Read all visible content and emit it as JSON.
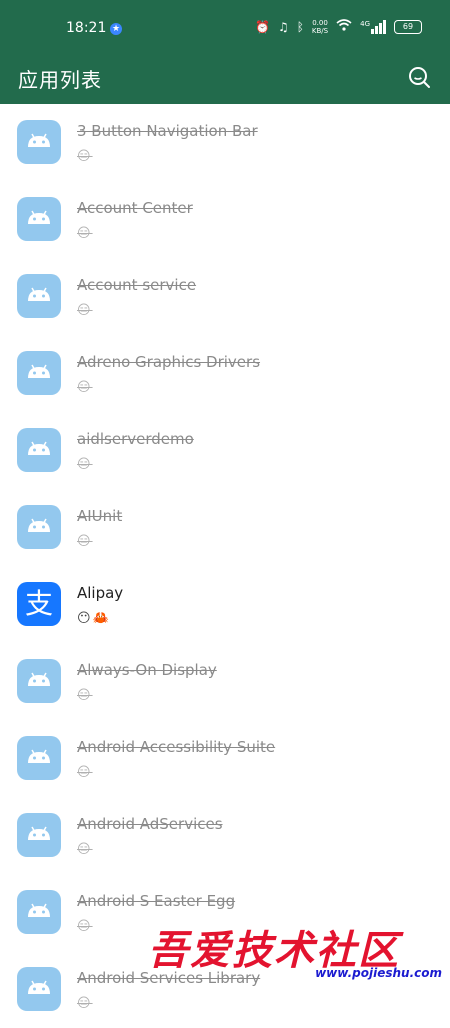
{
  "status": {
    "time": "18:21",
    "speed_value": "0.00",
    "speed_unit": "KB/S",
    "network": "4G",
    "battery": "69"
  },
  "appbar": {
    "title": "应用列表"
  },
  "apps": [
    {
      "name": "3 Button Navigation Bar",
      "emoji": "😑"
    },
    {
      "name": "Account Center",
      "emoji": "😑"
    },
    {
      "name": "Account service",
      "emoji": "😑"
    },
    {
      "name": "Adreno Graphics Drivers",
      "emoji": "😑"
    },
    {
      "name": "aidlserverdemo",
      "emoji": "😑"
    },
    {
      "name": "AIUnit",
      "emoji": "😑"
    },
    {
      "name": "Alipay",
      "emoji": "😶🦀"
    },
    {
      "name": "Always-On Display",
      "emoji": "😑"
    },
    {
      "name": "Android Accessibility Suite",
      "emoji": "😑"
    },
    {
      "name": "Android AdServices",
      "emoji": "😑"
    },
    {
      "name": "Android S Easter Egg",
      "emoji": "😑"
    },
    {
      "name": "Android Services Library",
      "emoji": "😑"
    }
  ],
  "alipay_glyph": "支",
  "watermark": {
    "text": "吾爱技术社区",
    "url": "www.pojieshu.com"
  },
  "colors": {
    "appbar": "#226b4c",
    "android_icon": "#93c8ee",
    "alipay": "#1677ff",
    "watermark": "#e3132f"
  }
}
